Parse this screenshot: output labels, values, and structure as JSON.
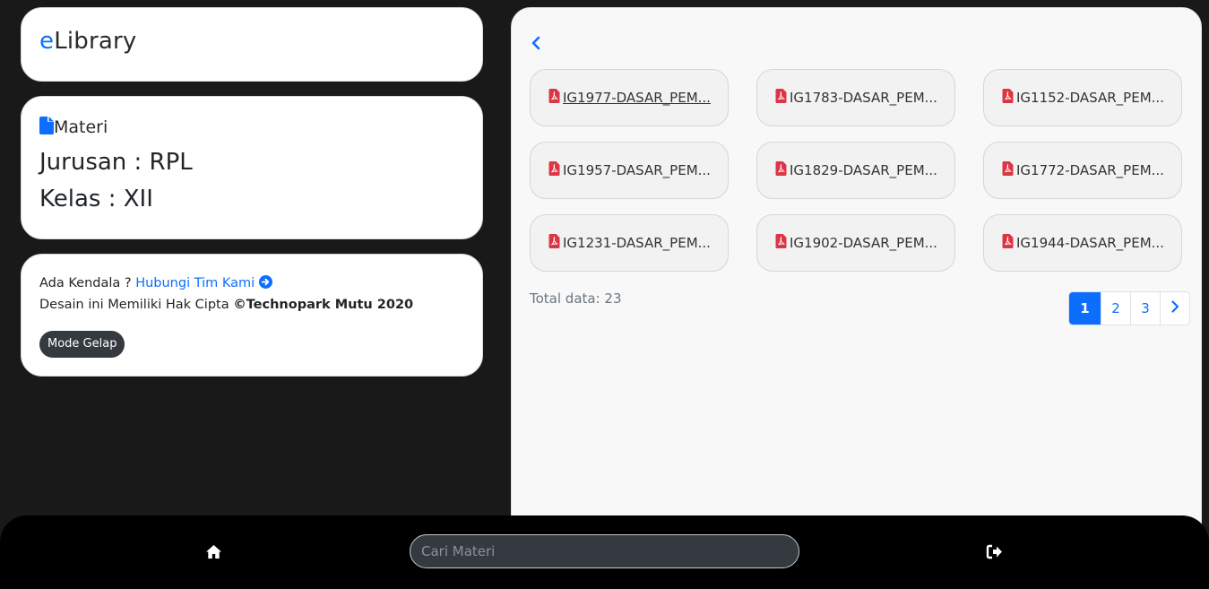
{
  "brand": {
    "prefix": "e",
    "rest": "Library"
  },
  "info": {
    "section_label": "Materi",
    "jurusan": "Jurusan : RPL",
    "kelas": "Kelas : XII"
  },
  "footer": {
    "help_prefix": "Ada Kendala ? ",
    "help_link": "Hubungi Tim Kami",
    "copyright_prefix": "Desain ini Memiliki Hak Cipta ",
    "copyright_brand": "©Technopark Mutu 2020",
    "mode_button": "Mode Gelap"
  },
  "files": [
    "IG1977-DASAR_PEM...",
    "IG1783-DASAR_PEM...",
    "IG1152-DASAR_PEM...",
    "IG1957-DASAR_PEM...",
    "IG1829-DASAR_PEM...",
    "IG1772-DASAR_PEM...",
    "IG1231-DASAR_PEM...",
    "IG1902-DASAR_PEM...",
    "IG1944-DASAR_PEM..."
  ],
  "total": "Total data: 23",
  "pagination": {
    "pages": [
      "1",
      "2",
      "3"
    ],
    "current": "1"
  },
  "search": {
    "placeholder": "Cari Materi"
  },
  "icons": {
    "file": "file-icon",
    "pdf": "file-pdf-icon",
    "back": "chevron-left-icon",
    "next": "chevron-right-icon",
    "home": "home-icon",
    "logout": "sign-out-icon",
    "help": "arrow-circle-right-icon"
  },
  "colors": {
    "accent": "#0d6efd",
    "pdf": "#dc3545",
    "dark_button": "#343a40"
  }
}
